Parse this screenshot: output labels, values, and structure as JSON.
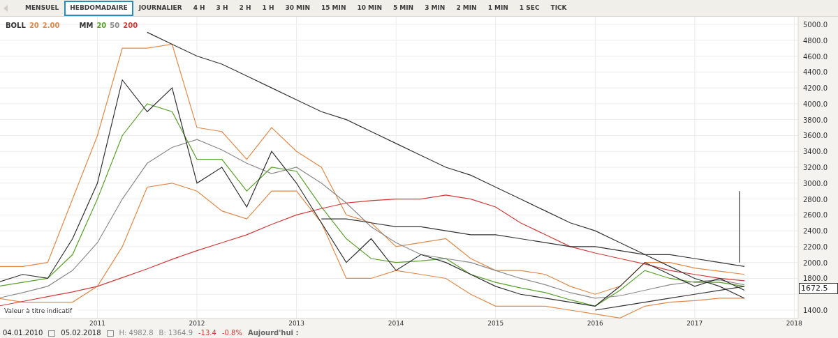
{
  "tabs": [
    {
      "label": "MENSUEL",
      "selected": false
    },
    {
      "label": "HEBDOMADAIRE",
      "selected": true
    },
    {
      "label": "JOURNALIER",
      "selected": false
    },
    {
      "label": "4 H",
      "selected": false
    },
    {
      "label": "3 H",
      "selected": false
    },
    {
      "label": "2 H",
      "selected": false
    },
    {
      "label": "1 H",
      "selected": false
    },
    {
      "label": "30 MIN",
      "selected": false
    },
    {
      "label": "15 MIN",
      "selected": false
    },
    {
      "label": "10 MIN",
      "selected": false
    },
    {
      "label": "5 MIN",
      "selected": false
    },
    {
      "label": "3 MIN",
      "selected": false
    },
    {
      "label": "2 MIN",
      "selected": false
    },
    {
      "label": "1 MIN",
      "selected": false
    },
    {
      "label": "1 SEC",
      "selected": false
    },
    {
      "label": "TICK",
      "selected": false
    }
  ],
  "legend": [
    {
      "name": "BOLL",
      "params": [
        {
          "text": "20",
          "color": "#e0894a"
        },
        {
          "text": "2.00",
          "color": "#e0894a"
        }
      ]
    },
    {
      "name": "MM",
      "params": [
        {
          "text": "20",
          "color": "#5aa02c"
        },
        {
          "text": "50",
          "color": "#8a8a8a"
        },
        {
          "text": "200",
          "color": "#d23a3a"
        }
      ]
    }
  ],
  "chart": {
    "note": "Valeur à titre indicatif",
    "last_price": "1672.5",
    "chart_data": {
      "type": "line",
      "xlim": [
        2010,
        2018.04
      ],
      "ylim": [
        1300,
        5000
      ],
      "grid": true,
      "ref_lines": [
        {
          "axis": "x",
          "value": 2017.45,
          "color": "#333333"
        }
      ],
      "x": [
        2010,
        2010.25,
        2010.5,
        2010.75,
        2011,
        2011.25,
        2011.5,
        2011.75,
        2012,
        2012.25,
        2012.5,
        2012.75,
        2013,
        2013.25,
        2013.5,
        2013.75,
        2014,
        2014.25,
        2014.5,
        2014.75,
        2015,
        2015.25,
        2015.5,
        2015.75,
        2016,
        2016.25,
        2016.5,
        2016.75,
        2017,
        2017.25,
        2017.5
      ],
      "xticks": [
        {
          "value": 2011,
          "label": "2011"
        },
        {
          "value": 2012,
          "label": "2012"
        },
        {
          "value": 2013,
          "label": "2013"
        },
        {
          "value": 2014,
          "label": "2014"
        },
        {
          "value": 2015,
          "label": "2015"
        },
        {
          "value": 2016,
          "label": "2016"
        },
        {
          "value": 2017,
          "label": "2017"
        },
        {
          "value": 2018,
          "label": "2018"
        }
      ],
      "yticks": [
        {
          "value": 1400,
          "label": "1400.0"
        },
        {
          "value": 1800,
          "label": "1800.0"
        },
        {
          "value": 2000,
          "label": "2000.0"
        },
        {
          "value": 2200,
          "label": "2200.0"
        },
        {
          "value": 2400,
          "label": "2400.0"
        },
        {
          "value": 2600,
          "label": "2600.0"
        },
        {
          "value": 2800,
          "label": "2800.0"
        },
        {
          "value": 3000,
          "label": "3000.0"
        },
        {
          "value": 3200,
          "label": "3200.0"
        },
        {
          "value": 3400,
          "label": "3400.0"
        },
        {
          "value": 3600,
          "label": "3600.0"
        },
        {
          "value": 3800,
          "label": "3800.0"
        },
        {
          "value": 4000,
          "label": "4000.0"
        },
        {
          "value": 4200,
          "label": "4200.0"
        },
        {
          "value": 4400,
          "label": "4400.0"
        },
        {
          "value": 4600,
          "label": "4600.0"
        },
        {
          "value": 4800,
          "label": "4800.0"
        },
        {
          "value": 5000,
          "label": "5000.0"
        }
      ],
      "series": [
        {
          "color": "#e0894a",
          "values": [
            1950,
            1950,
            2000,
            2800,
            3600,
            4700,
            4700,
            4750,
            3700,
            3650,
            3300,
            3700,
            3400,
            3200,
            2600,
            2500,
            2200,
            2250,
            2300,
            2050,
            1900,
            1900,
            1850,
            1700,
            1600,
            1700,
            2000,
            2000,
            1930,
            1890,
            1850
          ]
        },
        {
          "color": "#e0894a",
          "values": [
            1550,
            1500,
            1500,
            1500,
            1700,
            2200,
            2950,
            3000,
            2900,
            2650,
            2550,
            2900,
            2900,
            2500,
            1800,
            1800,
            1900,
            1850,
            1800,
            1600,
            1450,
            1450,
            1450,
            1400,
            1350,
            1300,
            1450,
            1500,
            1520,
            1550,
            1550
          ]
        },
        {
          "color": "#5aa02c",
          "values": [
            1700,
            1750,
            1800,
            2100,
            2800,
            3600,
            4000,
            3900,
            3300,
            3300,
            2900,
            3200,
            3150,
            2700,
            2300,
            2050,
            2000,
            2020,
            2050,
            1850,
            1750,
            1680,
            1620,
            1530,
            1450,
            1650,
            1900,
            1800,
            1750,
            1750,
            1700
          ]
        },
        {
          "color": "#8a8a8a",
          "values": [
            1550,
            1620,
            1700,
            1900,
            2250,
            2800,
            3250,
            3450,
            3550,
            3420,
            3250,
            3120,
            3200,
            3000,
            2750,
            2450,
            2250,
            2100,
            2050,
            2000,
            1900,
            1800,
            1720,
            1620,
            1550,
            1580,
            1650,
            1720,
            1760,
            1780,
            1720
          ]
        },
        {
          "color": "#d23a3a",
          "values": [
            1450,
            1510,
            1570,
            1630,
            1700,
            1810,
            1920,
            2040,
            2150,
            2250,
            2350,
            2480,
            2600,
            2680,
            2750,
            2780,
            2800,
            2800,
            2850,
            2800,
            2700,
            2500,
            2350,
            2200,
            2120,
            2050,
            1980,
            1900,
            1850,
            1800,
            1770
          ]
        },
        {
          "color": "#2f2f2f",
          "values": [
            1750,
            1850,
            1800,
            2300,
            3000,
            4300,
            3900,
            4200,
            3000,
            3200,
            2700,
            3400,
            3000,
            2500,
            2000,
            2300,
            1900,
            2100,
            2000,
            1850,
            1700,
            1600,
            1550,
            1500,
            1450,
            1700,
            2000,
            1850,
            1700,
            1800,
            1650
          ]
        },
        {
          "color": "#333333",
          "values": [
            null,
            null,
            null,
            null,
            null,
            null,
            4900,
            4750,
            4600,
            4500,
            4350,
            4200,
            4050,
            3900,
            3800,
            3650,
            3500,
            3350,
            3200,
            3100,
            2950,
            2800,
            2650,
            2500,
            2400,
            2250,
            2100,
            1950,
            1800,
            1700,
            1550
          ]
        },
        {
          "color": "#333333",
          "values": [
            null,
            null,
            null,
            null,
            null,
            null,
            null,
            null,
            null,
            null,
            null,
            null,
            null,
            2550,
            2550,
            2500,
            2450,
            2450,
            2400,
            2350,
            2350,
            2300,
            2250,
            2200,
            2200,
            2150,
            2100,
            2100,
            2050,
            2000,
            1950
          ]
        },
        {
          "color": "#333333",
          "values": [
            null,
            null,
            null,
            null,
            null,
            null,
            null,
            null,
            null,
            null,
            null,
            null,
            null,
            null,
            null,
            null,
            null,
            null,
            null,
            null,
            null,
            null,
            null,
            null,
            1400,
            1450,
            1500,
            1550,
            1600,
            1650,
            1700
          ]
        }
      ]
    }
  },
  "status_bar": {
    "start_date": "04.01.2010",
    "end_date": "05.02.2018",
    "high": "H: 4982.8",
    "low": "B: 1364.9",
    "change": "-13.4",
    "change_percent": "-0.8%",
    "today": "Aujourd'hui :"
  }
}
